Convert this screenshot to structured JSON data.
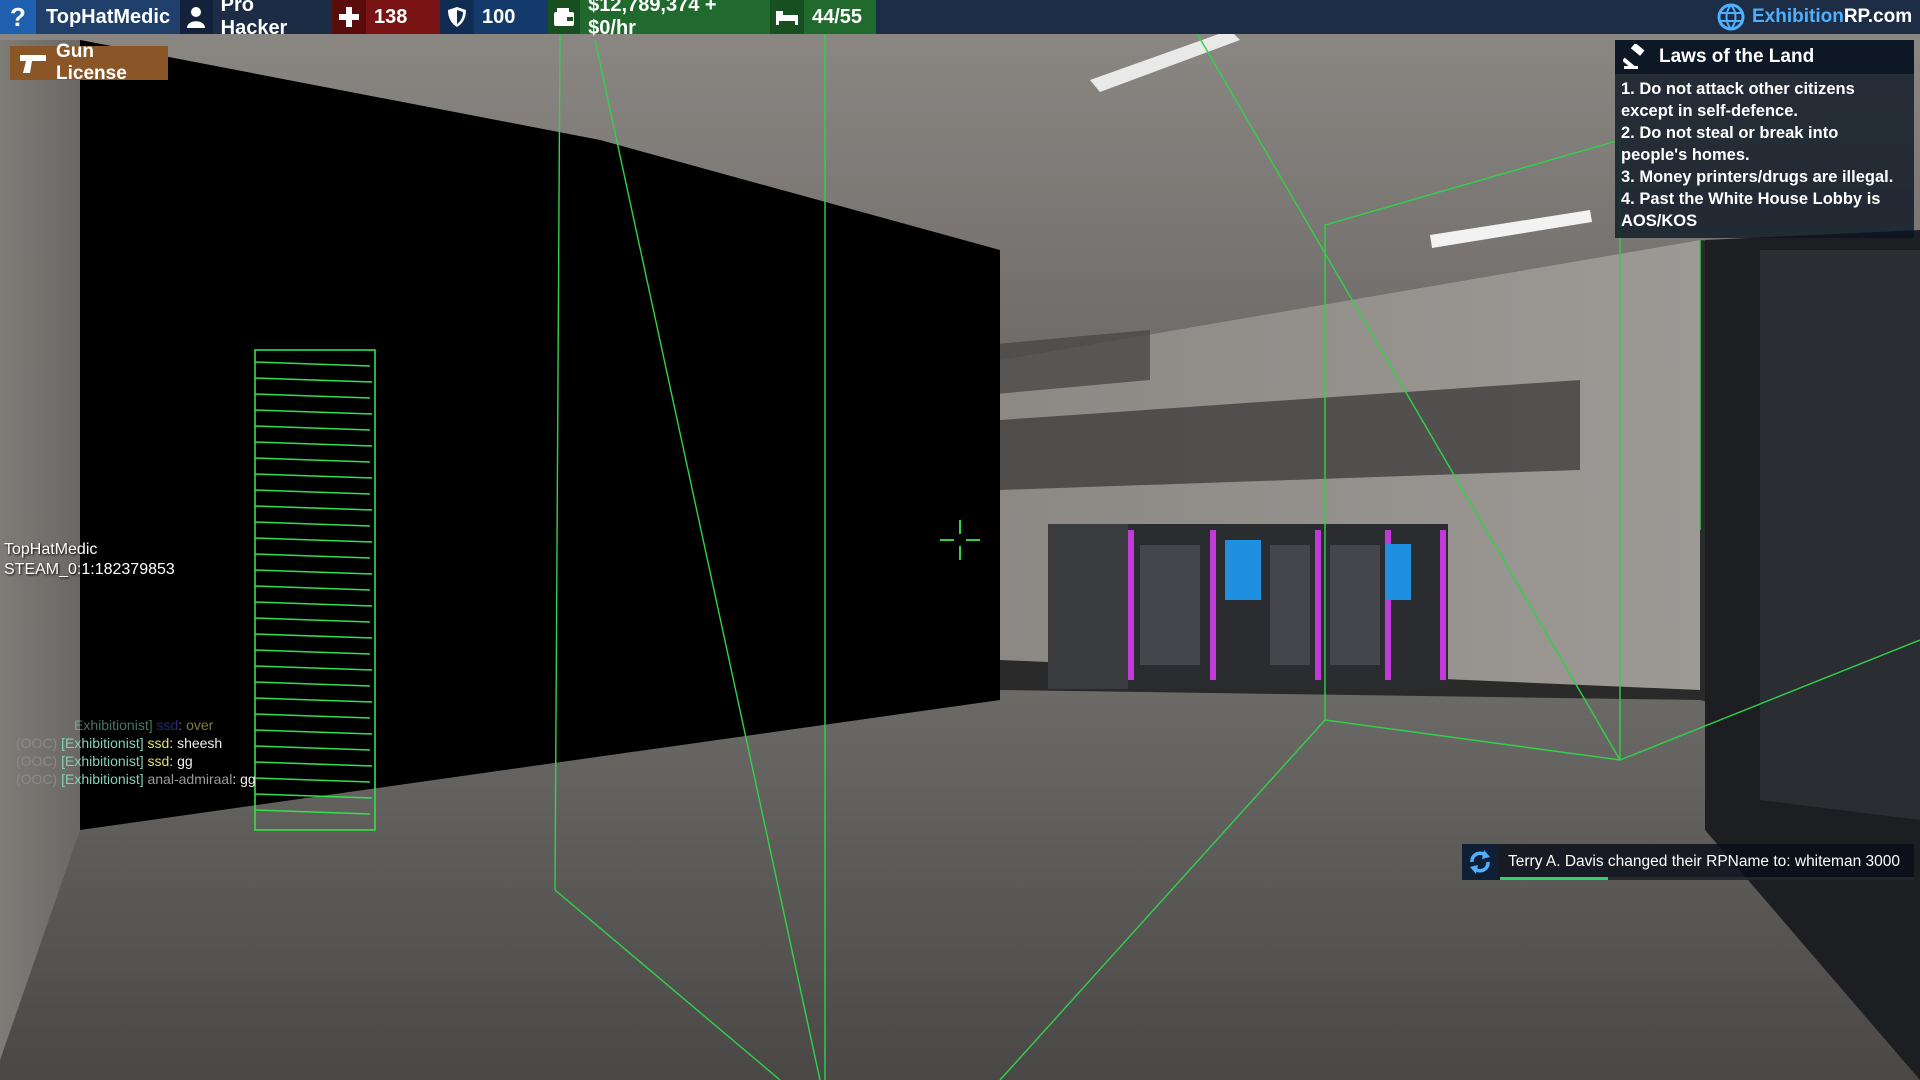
{
  "hud": {
    "player_name": "TopHatMedic",
    "job": "Pro Hacker",
    "health": "138",
    "armor": "100",
    "money": "$12,789,374 + $0/hr",
    "hunger": "44/55",
    "brand_main": "Exhibition",
    "brand_suffix": "RP.com",
    "colors": {
      "health": "#7a1313",
      "armor": "#143a6b",
      "money": "#1f6a2c",
      "brand": "#4fb0ff"
    },
    "icons": [
      "help-icon",
      "user-icon",
      "health-cross-icon",
      "shield-icon",
      "wallet-icon",
      "bed-icon",
      "globe-logo-icon"
    ]
  },
  "license": {
    "label": "Gun License",
    "icon": "pistol-icon"
  },
  "laws": {
    "title": "Laws of the Land",
    "icon": "gavel-icon",
    "items": [
      "1. Do not attack other citizens except in self-defence.",
      "2. Do not steal or break into people's homes.",
      "3. Money printers/drugs are illegal.",
      "4. Past the White House Lobby is AOS/KOS"
    ]
  },
  "player_info": {
    "name": "TopHatMedic",
    "steam_id": "STEAM_0:1:182379853"
  },
  "chat": [
    {
      "ooc": "",
      "tag": "Exhibitionist]",
      "name": "ssd",
      "msg": "over"
    },
    {
      "ooc": "(OOC)",
      "tag": "[Exhibitionist]",
      "name": "ssd",
      "msg": "sheesh"
    },
    {
      "ooc": "(OOC)",
      "tag": "[Exhibitionist]",
      "name": "ssd",
      "msg": "gg"
    },
    {
      "ooc": "(OOC)",
      "tag": "[Exhibitionist]",
      "name": "anal-admiraal",
      "msg": "gg"
    }
  ],
  "notification": {
    "text": "Terry A. Davis changed their RPName to: whiteman 3000",
    "icon": "refresh-icon",
    "progress": 0.26
  },
  "crosshair": {
    "color": "#2fd24a"
  }
}
